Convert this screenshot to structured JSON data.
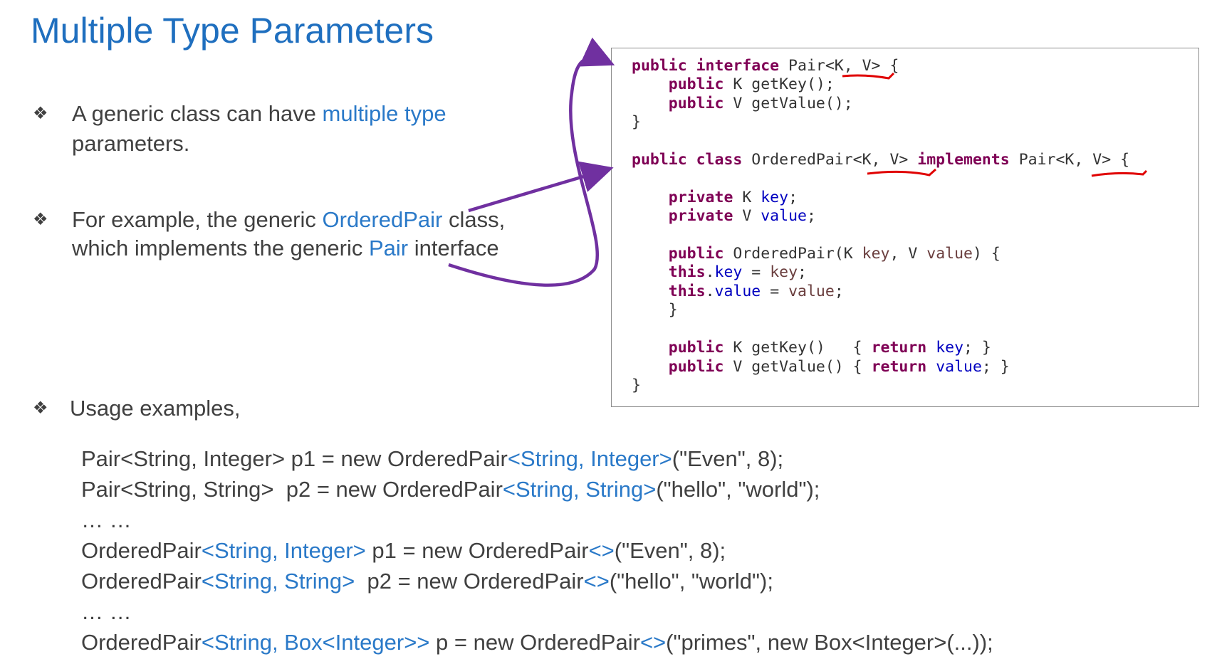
{
  "title": "Multiple Type Parameters",
  "bullets": {
    "b1": {
      "line1_pre": "A generic class can have ",
      "line1_hl": "multiple type",
      "line2": "parameters."
    },
    "b2": {
      "line1_pre": "For example, the generic ",
      "line1_hl": "OrderedPair",
      "line1_post": " class,",
      "line2_pre": "which implements the generic ",
      "line2_hl": "Pair",
      "line2_post": " interface"
    },
    "b3": {
      "text": "Usage examples,"
    }
  },
  "bullet_symbol": "❖",
  "code": {
    "l1_kw": "public interface",
    "l1_rest": " Pair<K, V> {",
    "l2_kw": "public",
    "l2_rest": " K getKey();",
    "l3_kw": "public",
    "l3_rest": " V getValue();",
    "l4": "}",
    "l6_kw": "public class",
    "l6_mid": " OrderedPair<K, V> ",
    "l6_kw2": "implements",
    "l6_rest": " Pair<K, V> {",
    "l8_kw": "private",
    "l8_type": " K ",
    "l8_fld": "key",
    "l8_end": ";",
    "l9_kw": "private",
    "l9_type": " V ",
    "l9_fld": "value",
    "l9_end": ";",
    "l11_kw": "public",
    "l11_a": " OrderedPair(K ",
    "l11_p1": "key",
    "l11_b": ", V ",
    "l11_p2": "value",
    "l11_c": ") {",
    "l12_kw": "this",
    "l12_a": ".",
    "l12_f": "key",
    "l12_b": " = ",
    "l12_p": "key",
    "l12_c": ";",
    "l13_kw": "this",
    "l13_a": ".",
    "l13_f": "value",
    "l13_b": " = ",
    "l13_p": "value",
    "l13_c": ";",
    "l14": "}",
    "l16_kw": "public",
    "l16_a": " K getKey()   { ",
    "l16_kw2": "return",
    "l16_b": " ",
    "l16_f": "key",
    "l16_c": "; }",
    "l17_kw": "public",
    "l17_a": " V getValue() { ",
    "l17_kw2": "return",
    "l17_b": " ",
    "l17_f": "value",
    "l17_c": "; }",
    "l18": "}"
  },
  "usage": {
    "u1_a": "Pair<String, Integer> p1 = new OrderedPair",
    "u1_hl": "<String, Integer>",
    "u1_b": "(\"Even\", 8);",
    "u2_a": "Pair<String, String>  p2 = new OrderedPair",
    "u2_hl": "<String, String>",
    "u2_b": "(\"hello\", \"world\");",
    "u3": "… …",
    "u4_a": "OrderedPair",
    "u4_hl": "<String, Integer>",
    "u4_b": " p1 = new OrderedPair",
    "u4_hl2": "<>",
    "u4_c": "(\"Even\", 8);",
    "u5_a": "OrderedPair",
    "u5_hl": "<String, String>",
    "u5_b": "  p2 = new OrderedPair",
    "u5_hl2": "<>",
    "u5_c": "(\"hello\", \"world\");",
    "u6": "… …",
    "u7_a": "OrderedPair",
    "u7_hl": "<String, Box<Integer>>",
    "u7_b": " p = new OrderedPair",
    "u7_hl2": "<>",
    "u7_c": "(\"primes\", new Box<Integer>(...));"
  },
  "colors": {
    "title": "#1f6fbf",
    "highlight": "#2a79c8",
    "keyword": "#7f0055",
    "field": "#0000c0",
    "annotation_arrow": "#7030a0",
    "annotation_underline": "#e00000"
  }
}
